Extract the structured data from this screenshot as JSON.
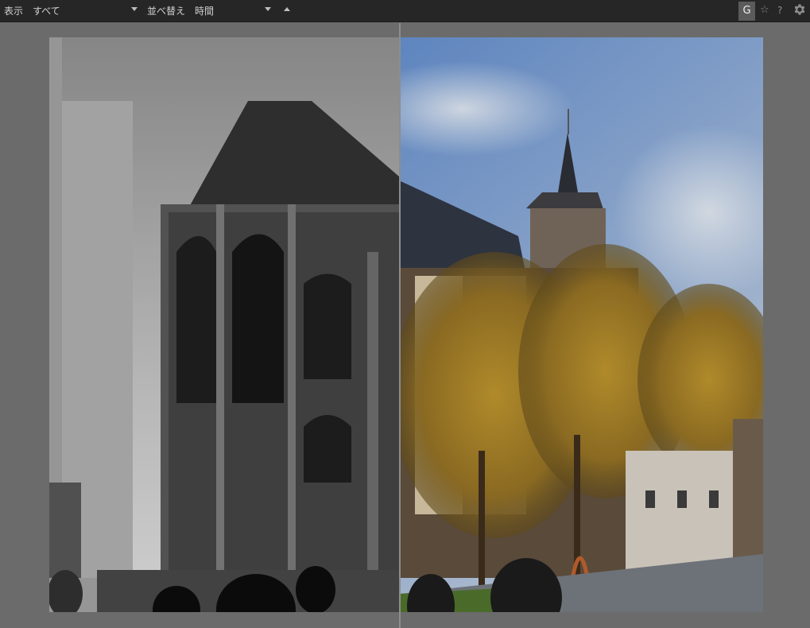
{
  "toolbar": {
    "display_label": "表示",
    "display_value": "すべて",
    "sort_label": "並べ替え",
    "sort_value": "時間",
    "g_button": "G",
    "star_icon": "☆",
    "help_icon": "?",
    "settings_icon": "gear-icon"
  },
  "colors": {
    "toolbar_bg": "#262626",
    "viewer_bg": "#6b6b6b",
    "active_button": "#5b5b5b"
  }
}
